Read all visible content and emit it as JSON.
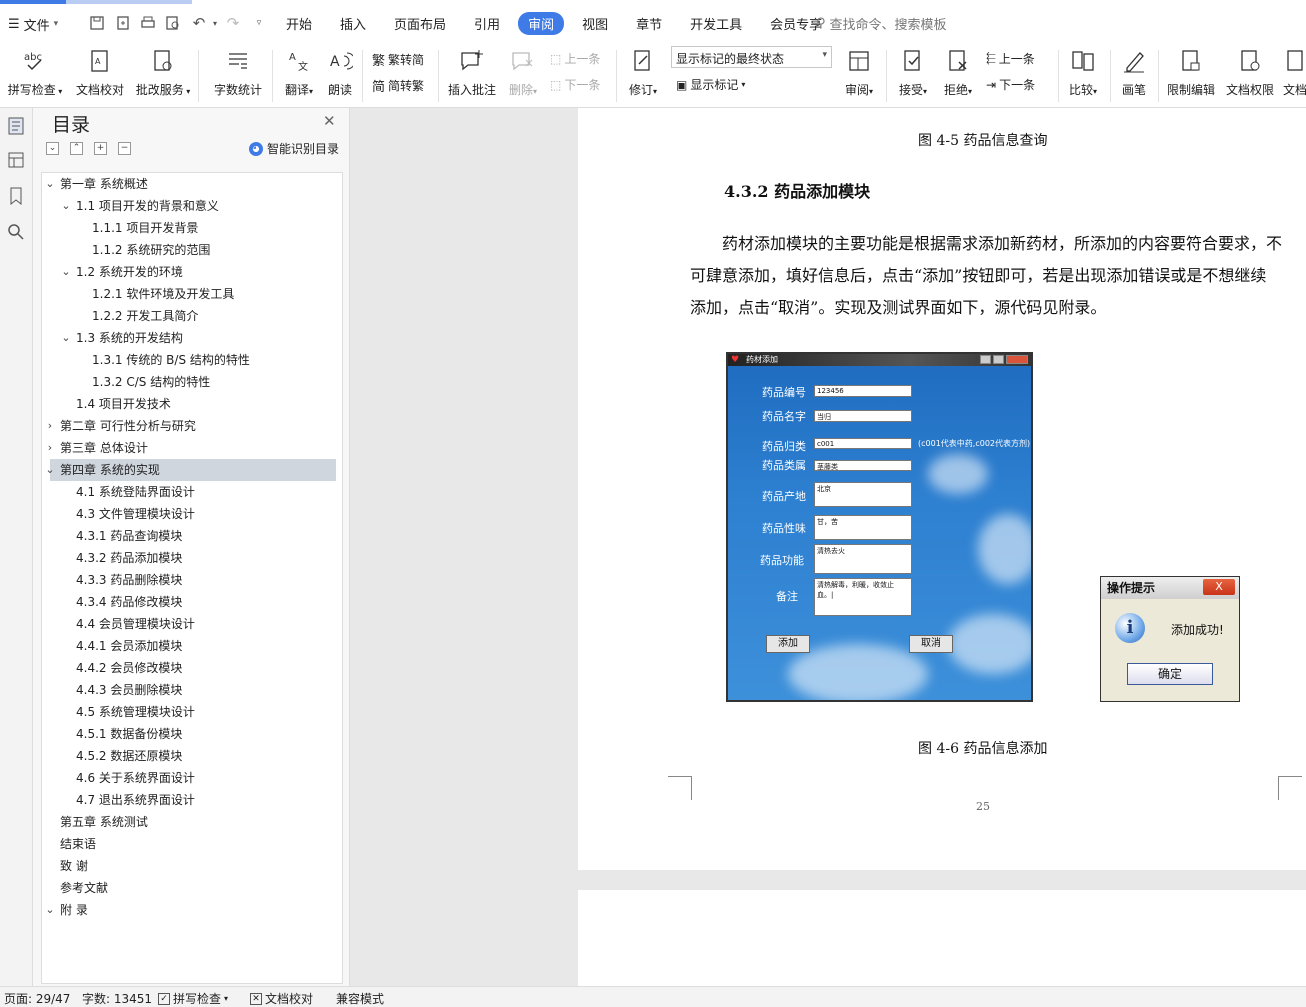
{
  "menubar": {
    "file_label": "文件",
    "tabs": [
      {
        "label": "开始",
        "active": false
      },
      {
        "label": "插入",
        "active": false
      },
      {
        "label": "页面布局",
        "active": false
      },
      {
        "label": "引用",
        "active": false
      },
      {
        "label": "审阅",
        "active": true
      },
      {
        "label": "视图",
        "active": false
      },
      {
        "label": "章节",
        "active": false
      },
      {
        "label": "开发工具",
        "active": false
      },
      {
        "label": "会员专享",
        "active": false
      }
    ],
    "search_placeholder": "查找命令、搜索模板",
    "accent_color": "#3f7be6"
  },
  "ribbon": {
    "spell_check": "拼写检查",
    "doc_proof": "文档校对",
    "revise_service": "批改服务",
    "word_count": "字数统计",
    "translate": "翻译",
    "read_aloud": "朗读",
    "trad_to_simp": "繁转简",
    "simp_to_trad": "简转繁",
    "insert_comment": "插入批注",
    "delete": "删除",
    "prev_comment": "上一条",
    "next_comment": "下一条",
    "track_changes": "修订",
    "display_mode": "显示标记的最终状态",
    "show_markup": "显示标记",
    "review": "审阅",
    "accept": "接受",
    "reject": "拒绝",
    "prev_change": "上一条",
    "next_change": "下一条",
    "compare": "比较",
    "pen": "画笔",
    "restrict_edit": "限制编辑",
    "doc_permission": "文档权限",
    "doc_more": "文档"
  },
  "toc": {
    "title": "目录",
    "smart_label": "智能识别目录",
    "items": [
      {
        "text": "第一章  系统概述",
        "level": 0,
        "chev": "down"
      },
      {
        "text": "1.1  项目开发的背景和意义",
        "level": 1,
        "chev": "down"
      },
      {
        "text": "1.1.1  项目开发背景",
        "level": 2,
        "chev": ""
      },
      {
        "text": "1.1.2  系统研究的范围",
        "level": 2,
        "chev": ""
      },
      {
        "text": "1.2  系统开发的环境",
        "level": 1,
        "chev": "down"
      },
      {
        "text": "1.2.1  软件环境及开发工具",
        "level": 2,
        "chev": ""
      },
      {
        "text": "1.2.2  开发工具简介",
        "level": 2,
        "chev": ""
      },
      {
        "text": "1.3  系统的开发结构",
        "level": 1,
        "chev": "down"
      },
      {
        "text": "1.3.1  传统的 B/S 结构的特性",
        "level": 2,
        "chev": ""
      },
      {
        "text": "1.3.2 C/S  结构的特性",
        "level": 2,
        "chev": ""
      },
      {
        "text": "1.4  项目开发技术",
        "level": 1,
        "chev": ""
      },
      {
        "text": "第二章  可行性分析与研究",
        "level": 0,
        "chev": "right"
      },
      {
        "text": "第三章  总体设计",
        "level": 0,
        "chev": "right"
      },
      {
        "text": "第四章  系统的实现",
        "level": 0,
        "chev": "down",
        "selected": true
      },
      {
        "text": "4.1  系统登陆界面设计",
        "level": 1,
        "chev": ""
      },
      {
        "text": "4.3  文件管理模块设计",
        "level": 1,
        "chev": ""
      },
      {
        "text": "4.3.1 药品查询模块",
        "level": 1,
        "chev": ""
      },
      {
        "text": "4.3.2  药品添加模块",
        "level": 1,
        "chev": ""
      },
      {
        "text": "4.3.3 药品删除模块",
        "level": 1,
        "chev": ""
      },
      {
        "text": "4.3.4 药品修改模块",
        "level": 1,
        "chev": ""
      },
      {
        "text": "4.4 会员管理模块设计",
        "level": 1,
        "chev": ""
      },
      {
        "text": "4.4.1 会员添加模块",
        "level": 1,
        "chev": ""
      },
      {
        "text": "4.4.2 会员修改模块",
        "level": 1,
        "chev": ""
      },
      {
        "text": "4.4.3 会员删除模块",
        "level": 1,
        "chev": ""
      },
      {
        "text": "4.5  系统管理模块设计",
        "level": 1,
        "chev": ""
      },
      {
        "text": "4.5.1  数据备份模块",
        "level": 1,
        "chev": ""
      },
      {
        "text": "4.5.2  数据还原模块",
        "level": 1,
        "chev": ""
      },
      {
        "text": "4.6  关于系统界面设计",
        "level": 1,
        "chev": ""
      },
      {
        "text": "4.7  退出系统界面设计",
        "level": 1,
        "chev": ""
      },
      {
        "text": "第五章  系统测试",
        "level": 0,
        "chev": ""
      },
      {
        "text": "结束语",
        "level": 0,
        "chev": ""
      },
      {
        "text": "致   谢",
        "level": 0,
        "chev": ""
      },
      {
        "text": "参考文献",
        "level": 0,
        "chev": ""
      },
      {
        "text": "附   录",
        "level": 0,
        "chev": "down"
      }
    ]
  },
  "document": {
    "caption_top": "图 4-5  药品信息查询",
    "heading": "4.3.2  药品添加模块",
    "paragraph_lines": [
      "药材添加模块的主要功能是根据需求添加新药材，所添加的内容要符合要求，不",
      "可肆意添加，填好信息后，点击“添加”按钮即可，若是出现添加错误或是不想继续",
      "添加，点击“取消”。实现及测试界面如下，源代码见附录。"
    ],
    "caption_bottom": "图 4-6  药品信息添加",
    "page_number": "25",
    "app_window": {
      "title": "药材添加",
      "fields": [
        {
          "label": "药品编号",
          "value": "123456"
        },
        {
          "label": "药品名字",
          "value": "当归"
        },
        {
          "label": "药品归类",
          "value": "c001"
        },
        {
          "label": "药品类属",
          "value": "茎藤类"
        },
        {
          "label": "药品产地",
          "value": "北京"
        },
        {
          "label": "药品性味",
          "value": "甘，苦"
        },
        {
          "label": "药品功能",
          "value": "清热去火"
        },
        {
          "label": "备注",
          "value": "清热解毒，利暖，收敛止血。|"
        }
      ],
      "hint": "(c001代表中药,c002代表方剂)",
      "add_button": "添加",
      "cancel_button": "取消"
    },
    "dialog": {
      "title": "操作提示",
      "close": "X",
      "message": "添加成功!",
      "ok": "确定"
    }
  },
  "statusbar": {
    "page": "页面: 29/47",
    "word_count": "字数: 13451",
    "spell_check": "拼写检查",
    "doc_proof": "文档校对",
    "compat_mode": "兼容模式"
  }
}
